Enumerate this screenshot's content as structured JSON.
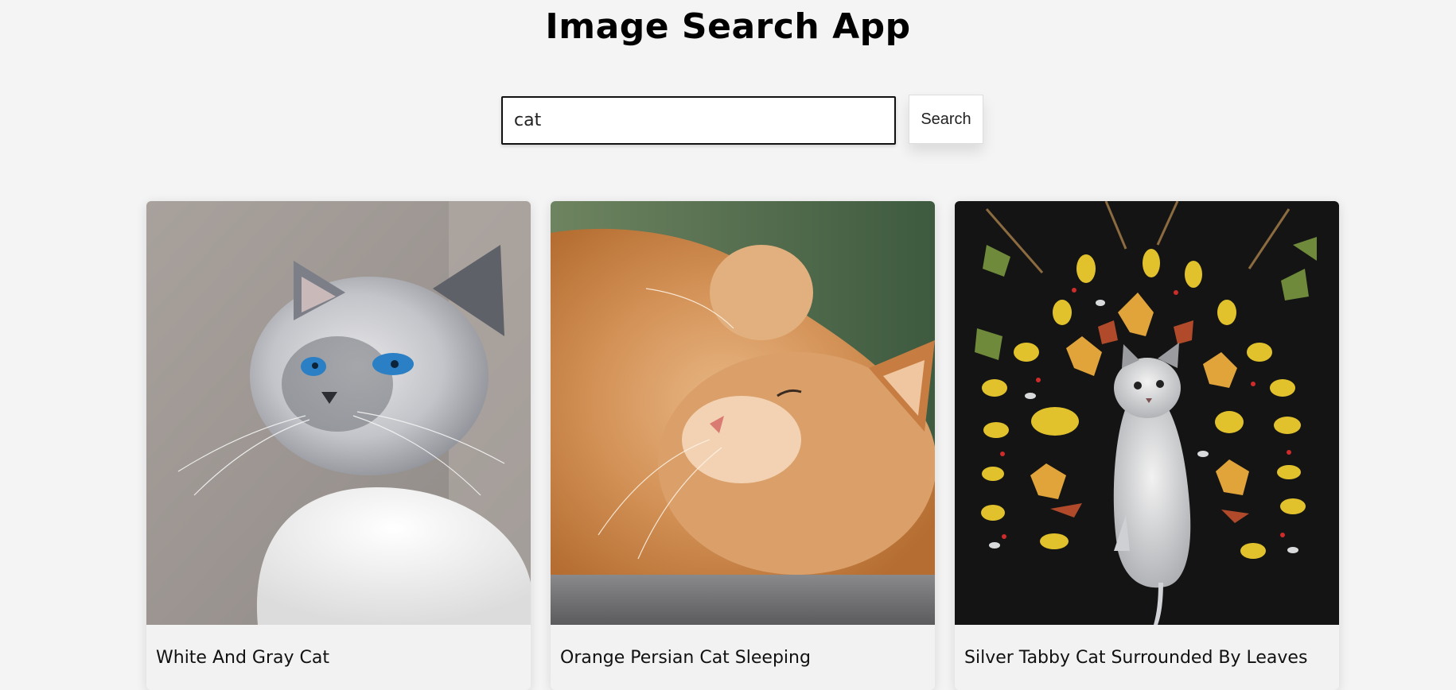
{
  "header": {
    "title": "Image Search App"
  },
  "search": {
    "value": "cat",
    "button_label": "Search"
  },
  "results": [
    {
      "title": "White And Gray Cat",
      "image_icon": "white-gray-cat-photo"
    },
    {
      "title": "Orange Persian Cat Sleeping",
      "image_icon": "orange-persian-cat-photo"
    },
    {
      "title": "Silver Tabby Cat Surrounded By Leaves",
      "image_icon": "silver-tabby-cat-leaves-photo"
    }
  ]
}
